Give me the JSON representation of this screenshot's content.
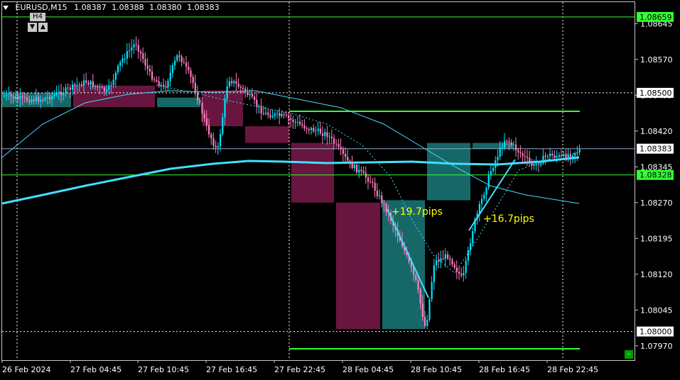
{
  "header": {
    "symbol": "EURUSD,M15",
    "open": "1.08387",
    "high": "1.08388",
    "low": "1.08380",
    "close": "1.08383"
  },
  "timeframe_panel": {
    "label": "H4",
    "down_arrow": "▼",
    "up_arrow": "▲"
  },
  "price_axis": {
    "ticks": [
      "1.08645",
      "1.08570",
      "1.08495",
      "1.08420",
      "1.08345",
      "1.08270",
      "1.08195",
      "1.08120",
      "1.08045",
      "1.07970"
    ],
    "highlighted_labels": [
      {
        "value": "1.08659",
        "style": "green"
      },
      {
        "value": "1.08500",
        "style": "white"
      },
      {
        "value": "1.08383",
        "style": "white"
      },
      {
        "value": "1.08328",
        "style": "green"
      },
      {
        "value": "1.08000",
        "style": "white"
      }
    ]
  },
  "time_axis": {
    "labels": [
      "26 Feb 2024",
      "27 Feb 04:45",
      "27 Feb 10:45",
      "27 Feb 16:45",
      "27 Feb 22:45",
      "28 Feb 04:45",
      "28 Feb 10:45",
      "28 Feb 16:45",
      "28 Feb 22:45"
    ]
  },
  "annotations": [
    {
      "text": "+19.7pips",
      "color": "#ffff00"
    },
    {
      "text": "+16.7pips",
      "color": "#ffff00"
    }
  ],
  "colors": {
    "background": "#000000",
    "bull_candle": "#00e5ff",
    "bear_candle": "#ff7fbf",
    "h4_bull_box": "#1a7a7a",
    "h4_bear_box": "#7a1a4a",
    "ma_slow": "#40e0ff",
    "level_line": "#33ff33",
    "grid": "#c8c8c8"
  },
  "minus_button": "-",
  "chart_data": {
    "type": "candlestick",
    "symbol": "EURUSD",
    "timeframe": "M15",
    "ylim": [
      1.0794,
      1.0869
    ],
    "key_levels": [
      1.08659,
      1.085,
      1.08383,
      1.08328,
      1.08
    ],
    "h4_boxes": [
      {
        "open": 1.0847,
        "close": 1.085,
        "dir": "bull"
      },
      {
        "open": 1.08515,
        "close": 1.0847,
        "dir": "bear"
      },
      {
        "open": 1.0847,
        "close": 1.0849,
        "dir": "bull"
      },
      {
        "open": 1.08505,
        "close": 1.0843,
        "dir": "bear"
      },
      {
        "open": 1.0843,
        "close": 1.08395,
        "dir": "bear"
      },
      {
        "open": 1.08395,
        "close": 1.0827,
        "dir": "bear"
      },
      {
        "open": 1.0827,
        "close": 1.08005,
        "dir": "bear"
      },
      {
        "open": 1.08005,
        "close": 1.08275,
        "dir": "bull"
      },
      {
        "open": 1.08275,
        "close": 1.08395,
        "dir": "bull"
      },
      {
        "open": 1.08395,
        "close": 1.08383,
        "dir": "bull"
      }
    ]
  }
}
